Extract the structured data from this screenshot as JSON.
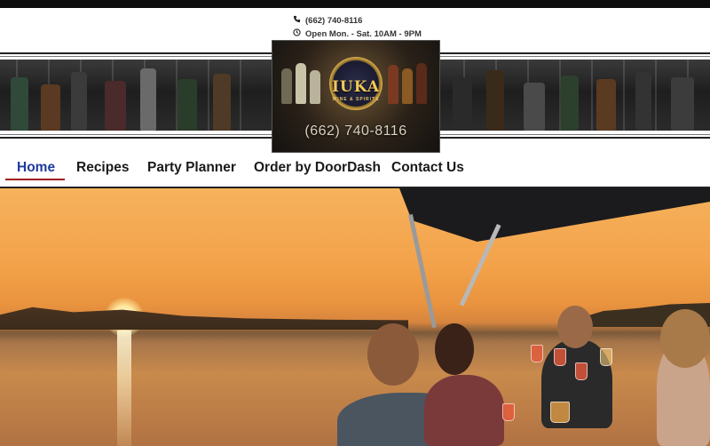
{
  "contact": {
    "phone": "(662) 740-8116",
    "hours": "Open Mon. - Sat. 10AM - 9PM",
    "phone_icon": "phone-icon",
    "clock_icon": "clock-icon"
  },
  "logo": {
    "title": "IUKA",
    "subtitle": "WINE & SPIRITS",
    "phone": "(662) 740-8116"
  },
  "nav": {
    "items": [
      {
        "label": "Home",
        "active": true
      },
      {
        "label": "Recipes",
        "active": false
      },
      {
        "label": "Party Planner",
        "active": false
      },
      {
        "label": "Order by DoorDash",
        "active": false
      },
      {
        "label": "Contact Us",
        "active": false
      }
    ]
  },
  "colors": {
    "nav_active": "#1f3a9e",
    "nav_underline": "#a11a1a",
    "text": "#1a1a1a"
  }
}
